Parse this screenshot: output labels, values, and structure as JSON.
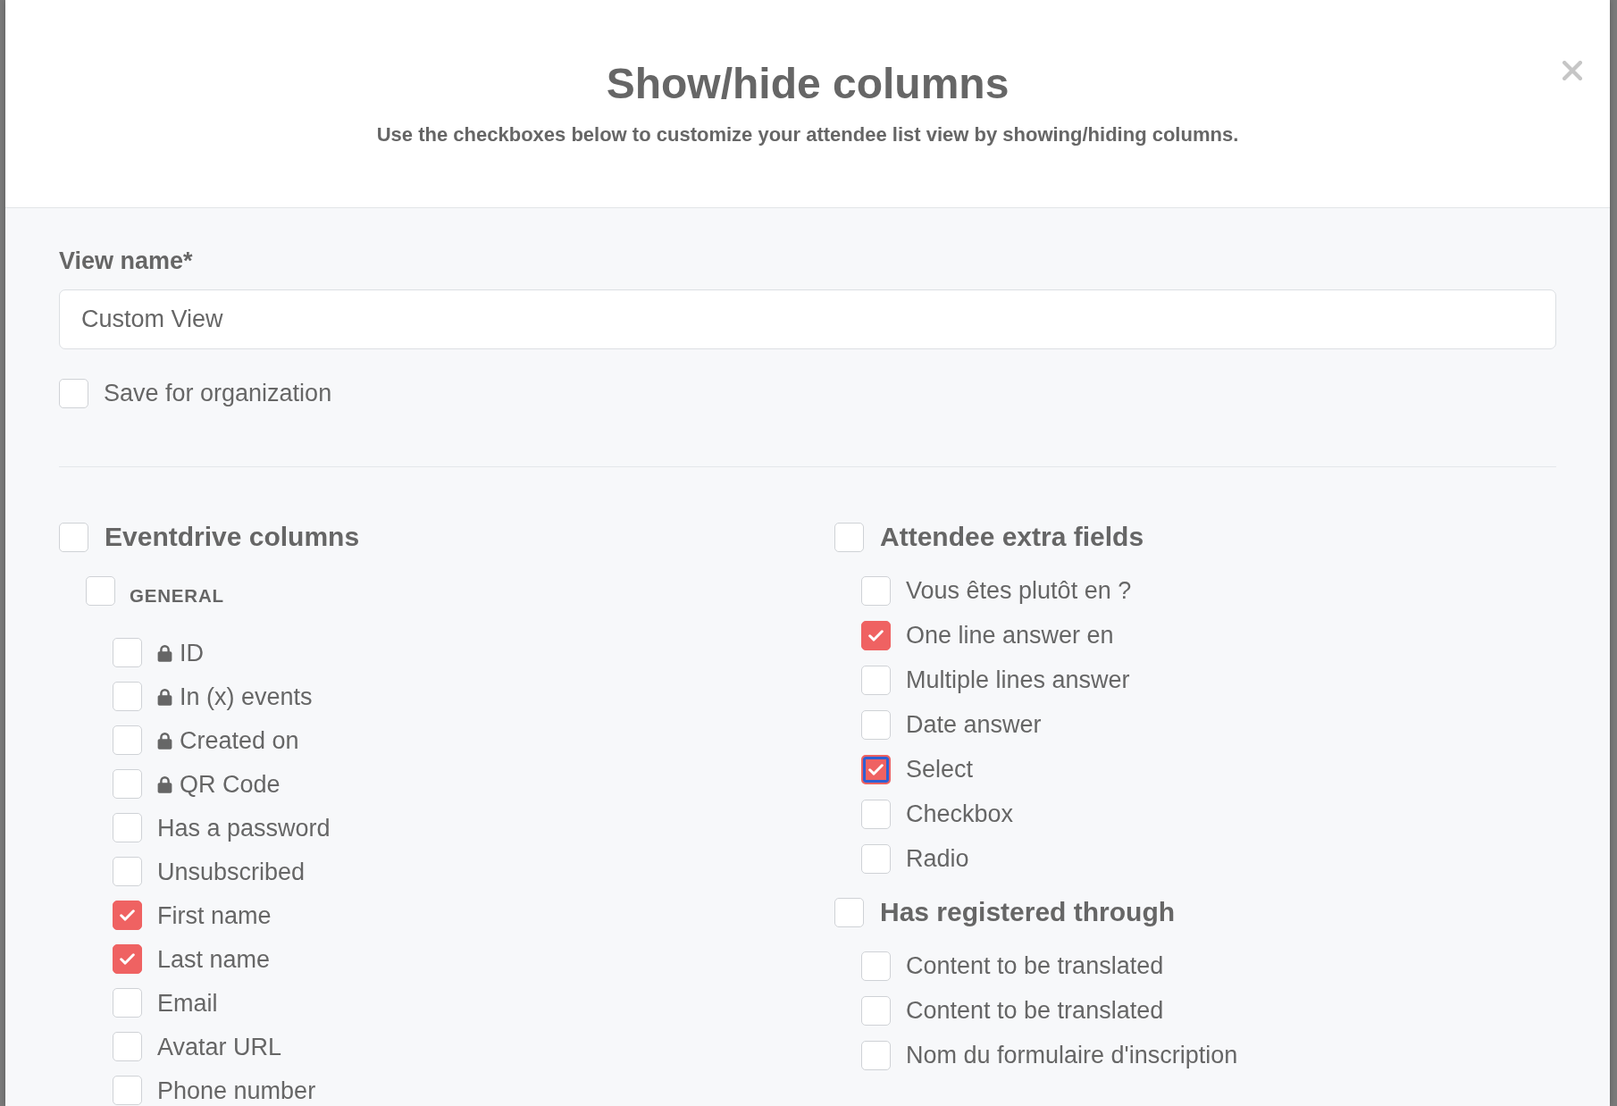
{
  "modal": {
    "title": "Show/hide columns",
    "subtitle": "Use the checkboxes below to customize your attendee list view by showing/hiding columns."
  },
  "view_name": {
    "label": "View name*",
    "value": "Custom View"
  },
  "save_for_organization": {
    "label": "Save for organization",
    "checked": false
  },
  "panes": [
    {
      "groups": [
        {
          "kind": "section",
          "label": "Eventdrive columns",
          "checked": false,
          "children": [
            {
              "kind": "category",
              "label": "GENERAL",
              "checked": false,
              "children": [
                {
                  "kind": "field",
                  "label": "ID",
                  "checked": false,
                  "locked": true
                },
                {
                  "kind": "field",
                  "label": "In (x) events",
                  "checked": false,
                  "locked": true
                },
                {
                  "kind": "field",
                  "label": "Created on",
                  "checked": false,
                  "locked": true
                },
                {
                  "kind": "field",
                  "label": "QR Code",
                  "checked": false,
                  "locked": true
                },
                {
                  "kind": "field",
                  "label": "Has a password",
                  "checked": false,
                  "locked": false
                },
                {
                  "kind": "field",
                  "label": "Unsubscribed",
                  "checked": false,
                  "locked": false
                },
                {
                  "kind": "field",
                  "label": "First name",
                  "checked": true,
                  "locked": false
                },
                {
                  "kind": "field",
                  "label": "Last name",
                  "checked": true,
                  "locked": false
                },
                {
                  "kind": "field",
                  "label": "Email",
                  "checked": false,
                  "locked": false
                },
                {
                  "kind": "field",
                  "label": "Avatar URL",
                  "checked": false,
                  "locked": false
                },
                {
                  "kind": "field",
                  "label": "Phone number",
                  "checked": false,
                  "locked": false
                }
              ]
            }
          ]
        }
      ]
    },
    {
      "groups": [
        {
          "kind": "section",
          "label": "Attendee extra fields",
          "checked": false,
          "children": [
            {
              "kind": "field",
              "label": "Vous êtes plutôt en ?",
              "checked": false,
              "focused": false
            },
            {
              "kind": "field",
              "label": "One line answer en",
              "checked": true,
              "focused": false
            },
            {
              "kind": "field",
              "label": "Multiple lines answer",
              "checked": false,
              "focused": false
            },
            {
              "kind": "field",
              "label": "Date answer",
              "checked": false,
              "focused": false
            },
            {
              "kind": "field",
              "label": "Select",
              "checked": true,
              "focused": true
            },
            {
              "kind": "field",
              "label": "Checkbox",
              "checked": false,
              "focused": false
            },
            {
              "kind": "field",
              "label": "Radio",
              "checked": false,
              "focused": false
            }
          ]
        },
        {
          "kind": "section",
          "label": "Has registered through",
          "checked": false,
          "children": [
            {
              "kind": "field",
              "label": "Content to be translated",
              "checked": false
            },
            {
              "kind": "field",
              "label": "Content to be translated",
              "checked": false
            },
            {
              "kind": "field",
              "label": "Nom du formulaire d'inscription",
              "checked": false
            }
          ]
        }
      ]
    }
  ]
}
